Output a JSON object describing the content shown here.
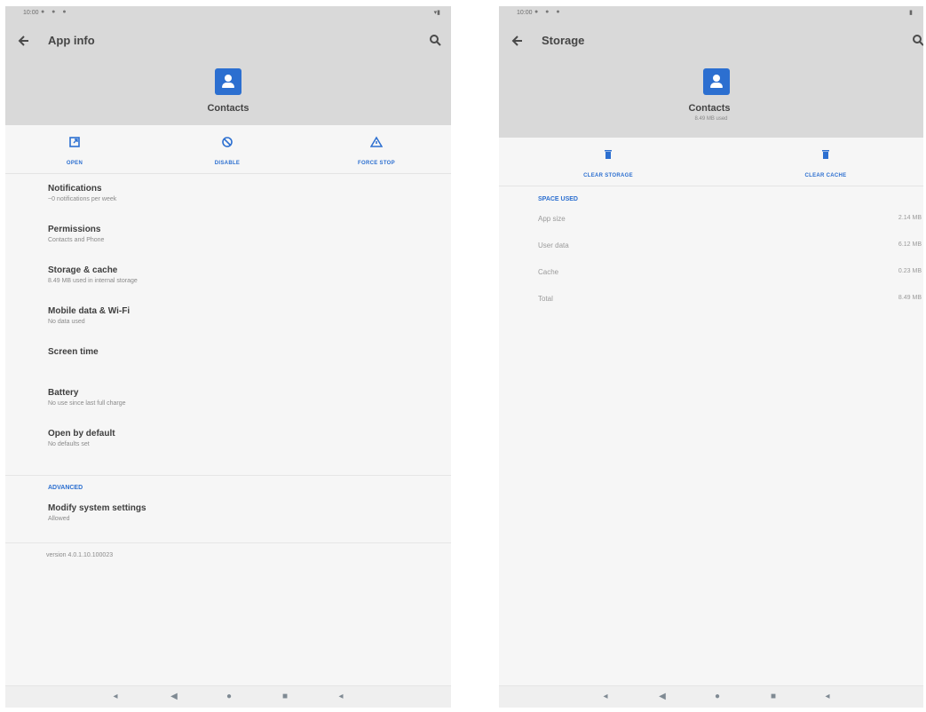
{
  "left": {
    "status_time": "10:00",
    "status_icons": "● ● ●",
    "status_right": "▾▮",
    "title": "App info",
    "app_name": "Contacts",
    "actions": [
      {
        "label": "OPEN",
        "icon": "open-icon"
      },
      {
        "label": "DISABLE",
        "icon": "disable-icon"
      },
      {
        "label": "FORCE STOP",
        "icon": "warning-icon"
      }
    ],
    "settings": [
      {
        "title": "Notifications",
        "sub": "~0 notifications per week"
      },
      {
        "title": "Permissions",
        "sub": "Contacts and Phone"
      },
      {
        "title": "Storage & cache",
        "sub": "8.49 MB used in internal storage"
      },
      {
        "title": "Mobile data & Wi-Fi",
        "sub": "No data used"
      },
      {
        "title": "Screen time",
        "sub": ""
      },
      {
        "title": "Battery",
        "sub": "No use since last full charge"
      },
      {
        "title": "Open by default",
        "sub": "No defaults set"
      }
    ],
    "advanced_header": "ADVANCED",
    "advanced_item": {
      "title": "Modify system settings",
      "sub": "Allowed"
    },
    "version": "version 4.0.1.10.100023"
  },
  "right": {
    "status_time": "10:00",
    "status_icons": "● ● ●",
    "status_right": "▮",
    "title": "Storage",
    "app_name": "Contacts",
    "app_sub": "8.49 MB used",
    "actions": [
      {
        "label": "CLEAR STORAGE",
        "icon": "trash-icon"
      },
      {
        "label": "CLEAR CACHE",
        "icon": "trash-icon"
      }
    ],
    "space_header": "SPACE USED",
    "rows": [
      {
        "label": "App size",
        "value": "2.14 MB"
      },
      {
        "label": "User data",
        "value": "6.12 MB"
      },
      {
        "label": "Cache",
        "value": "0.23 MB"
      },
      {
        "label": "Total",
        "value": "8.49 MB"
      }
    ]
  },
  "navbar": {
    "left_icons": [
      "volume-down-icon",
      "back-icon",
      "home-icon",
      "recents-icon",
      "volume-up-icon"
    ],
    "right_icons": [
      "volume-down-icon",
      "back-icon",
      "home-icon",
      "recents-icon",
      "volume-up-icon"
    ]
  },
  "colors": {
    "accent": "#2c6fd0",
    "appbar": "#d9d9d9",
    "background": "#f6f6f6"
  }
}
